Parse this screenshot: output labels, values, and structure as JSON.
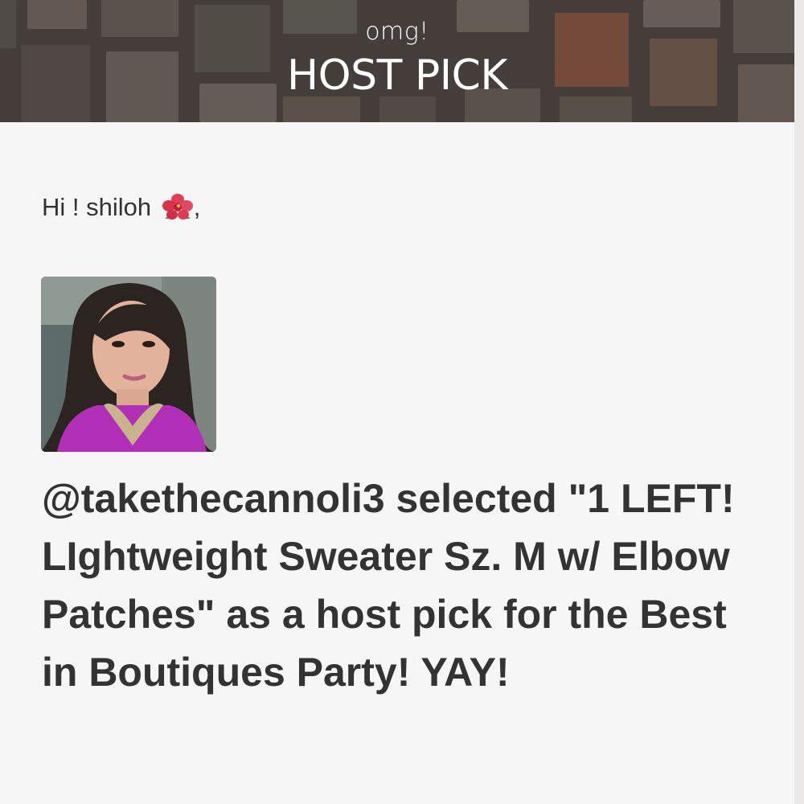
{
  "banner": {
    "eyebrow": "omg!",
    "title": "HOST PICK"
  },
  "greeting": {
    "prefix": "Hi ! shiloh",
    "icon": "hibiscus-icon",
    "suffix": ","
  },
  "avatar": {
    "alt": "Profile photo of takethecannoli3"
  },
  "message": {
    "text": "@takethecannoli3 selected \"1 LEFT! LIghtweight Sweater Sz. M w/ Elbow Patches\" as a host pick for the Best in Boutiques Party! YAY!"
  },
  "colors": {
    "text": "#333333",
    "background": "#f7f6f7",
    "banner_text": "#ffffff"
  }
}
